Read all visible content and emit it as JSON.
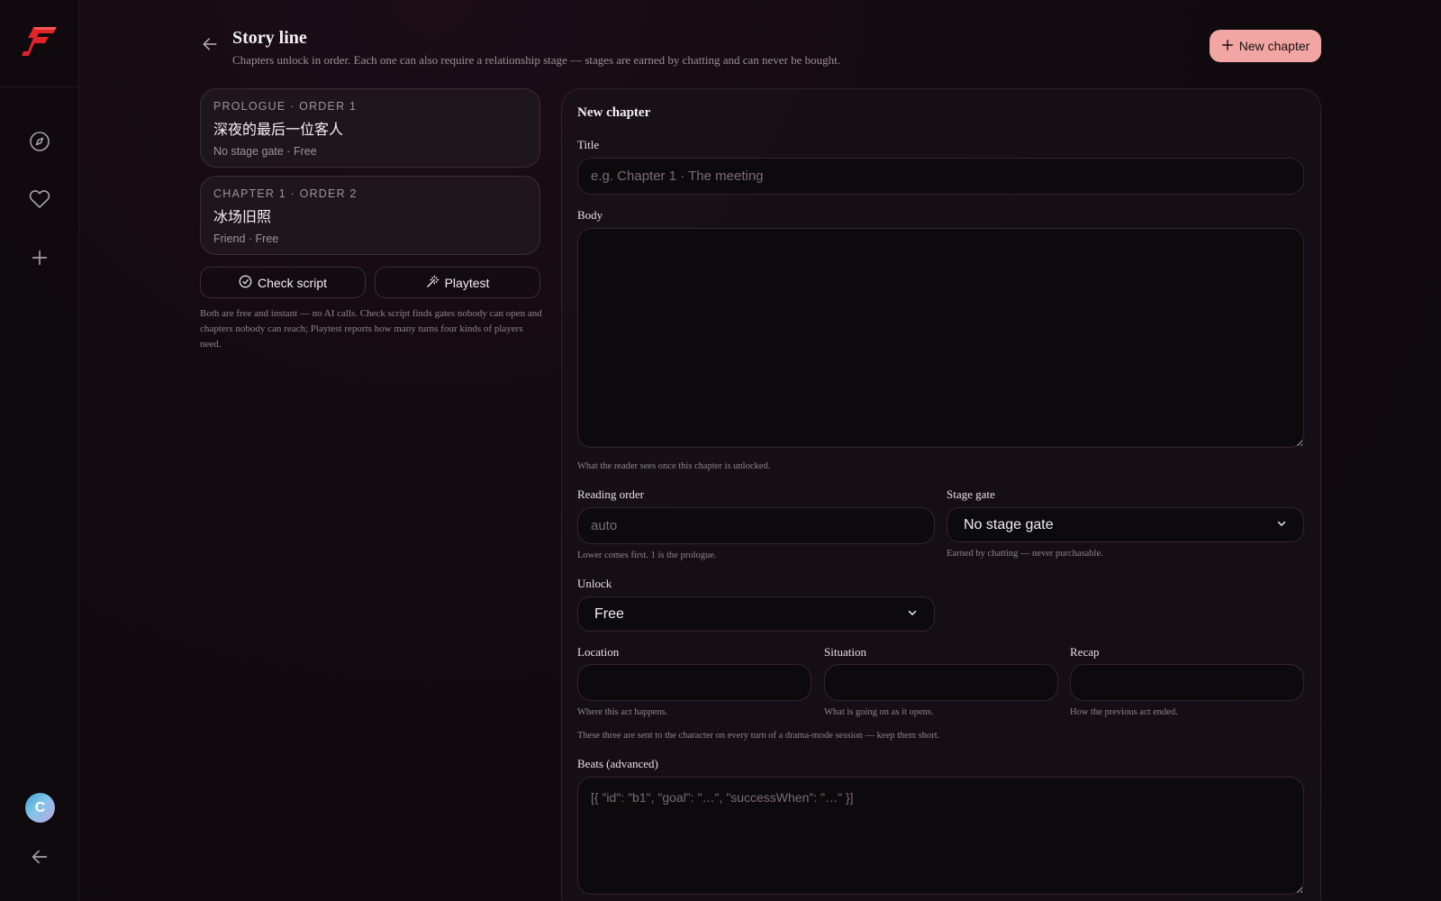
{
  "header": {
    "title": "Story line",
    "subtitle": "Chapters unlock in order. Each one can also require a relationship stage — stages are earned by chatting and can never be bought.",
    "new_chapter_label": "New chapter"
  },
  "chapters": [
    {
      "meta": "PROLOGUE · ORDER 1",
      "title": "深夜的最后一位客人",
      "sub": "No stage gate · Free"
    },
    {
      "meta": "CHAPTER 1 · ORDER 2",
      "title": "冰场旧照",
      "sub": "Friend · Free"
    }
  ],
  "tools": {
    "check_label": "Check script",
    "playtest_label": "Playtest",
    "note": "Both are free and instant — no AI calls. Check script finds gates nobody can open and chapters nobody can reach; Playtest reports how many turns four kinds of players need."
  },
  "form": {
    "heading": "New chapter",
    "title_label": "Title",
    "title_placeholder": "e.g. Chapter 1 · The meeting",
    "title_value": "",
    "body_label": "Body",
    "body_value": "",
    "body_hint": "What the reader sees once this chapter is unlocked.",
    "order_label": "Reading order",
    "order_placeholder": "auto",
    "order_hint": "Lower comes first. 1 is the prologue.",
    "stage_label": "Stage gate",
    "stage_value": "No stage gate",
    "stage_hint": "Earned by chatting — never purchasable.",
    "unlock_label": "Unlock",
    "unlock_value": "Free",
    "location_label": "Location",
    "location_hint": "Where this act happens.",
    "situation_label": "Situation",
    "situation_hint": "What is going on as it opens.",
    "recap_label": "Recap",
    "recap_hint": "How the previous act ended.",
    "drama_note": "These three are sent to the character on every turn of a drama-mode session — keep them short.",
    "beats_label": "Beats (advanced)",
    "beats_placeholder": "[{ \"id\": \"b1\", \"goal\": \"…\", \"successWhen\": \"…\" }]"
  },
  "sidebar": {
    "avatar_initial": "C"
  },
  "colors": {
    "accent": "#f2a6a3",
    "logo_red": "#e0242c"
  }
}
